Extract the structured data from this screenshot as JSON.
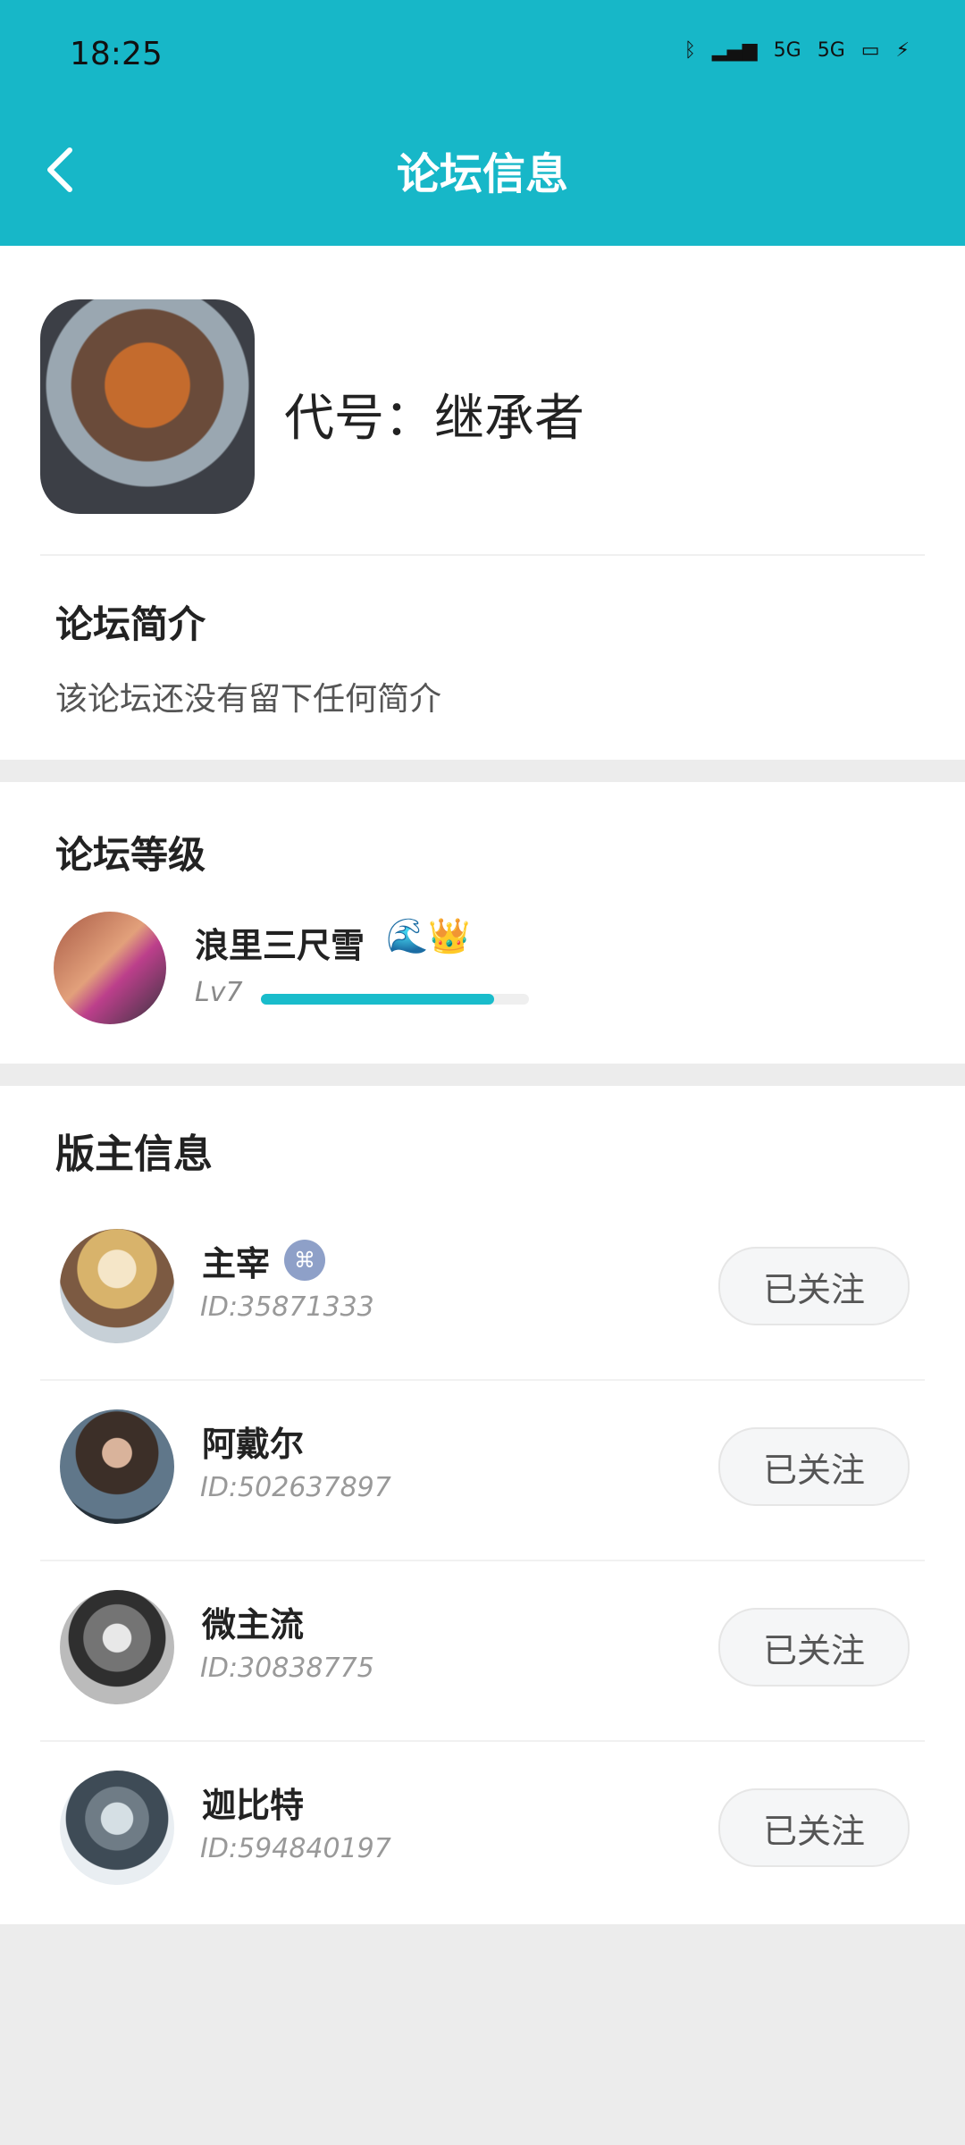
{
  "status": {
    "time": "18:25",
    "icons": [
      "bluetooth-icon",
      "signal-icon",
      "5G",
      "5G",
      "battery-icon",
      "charging-icon"
    ]
  },
  "header": {
    "title": "论坛信息",
    "back_icon": "chevron-left-icon"
  },
  "forum": {
    "name": "代号：继承者",
    "intro_title": "论坛简介",
    "intro_text": "该论坛还没有留下任何简介"
  },
  "level": {
    "title": "论坛等级",
    "name": "浪里三尺雪",
    "emojis": "🌊👑",
    "label": "Lv7",
    "progress": 0.87
  },
  "moderators": {
    "title": "版主信息",
    "follow_label": "已关注",
    "items": [
      {
        "name": "主宰",
        "id": "ID:35871333",
        "badge": "controller-icon"
      },
      {
        "name": "阿戴尔",
        "id": "ID:502637897"
      },
      {
        "name": "微主流",
        "id": "ID:30838775"
      },
      {
        "name": "迦比特",
        "id": "ID:594840197"
      }
    ]
  },
  "colors": {
    "header_bg": "#17b7c8",
    "progress_fill": "#19bccb",
    "page_bg": "#ececec"
  }
}
